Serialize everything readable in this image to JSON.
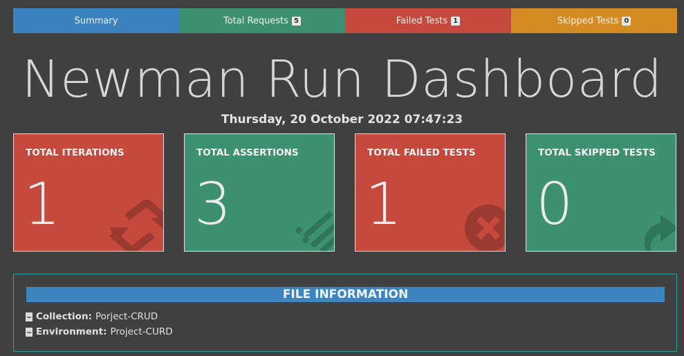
{
  "tabs": [
    {
      "label": "Summary",
      "badge": null,
      "color": "#3b82bf"
    },
    {
      "label": "Total Requests",
      "badge": "5",
      "color": "#3e9170"
    },
    {
      "label": "Failed Tests",
      "badge": "1",
      "color": "#c5493d"
    },
    {
      "label": "Skipped Tests",
      "badge": "0",
      "color": "#d68c24"
    }
  ],
  "title": "Newman Run Dashboard",
  "date": "Thursday, 20 October 2022 07:47:23",
  "cards": [
    {
      "label": "TOTAL ITERATIONS",
      "value": "1",
      "icon": "refresh-icon"
    },
    {
      "label": "TOTAL ASSERTIONS",
      "value": "3",
      "icon": "list-icon"
    },
    {
      "label": "TOTAL FAILED TESTS",
      "value": "1",
      "icon": "times-circle-icon"
    },
    {
      "label": "TOTAL SKIPPED TESTS",
      "value": "0",
      "icon": "share-icon"
    }
  ],
  "file_info": {
    "header": "FILE INFORMATION",
    "collection_label": "Collection:",
    "collection_value": "Porject-CRUD",
    "environment_label": "Environment:",
    "environment_value": "Project-CURD"
  }
}
